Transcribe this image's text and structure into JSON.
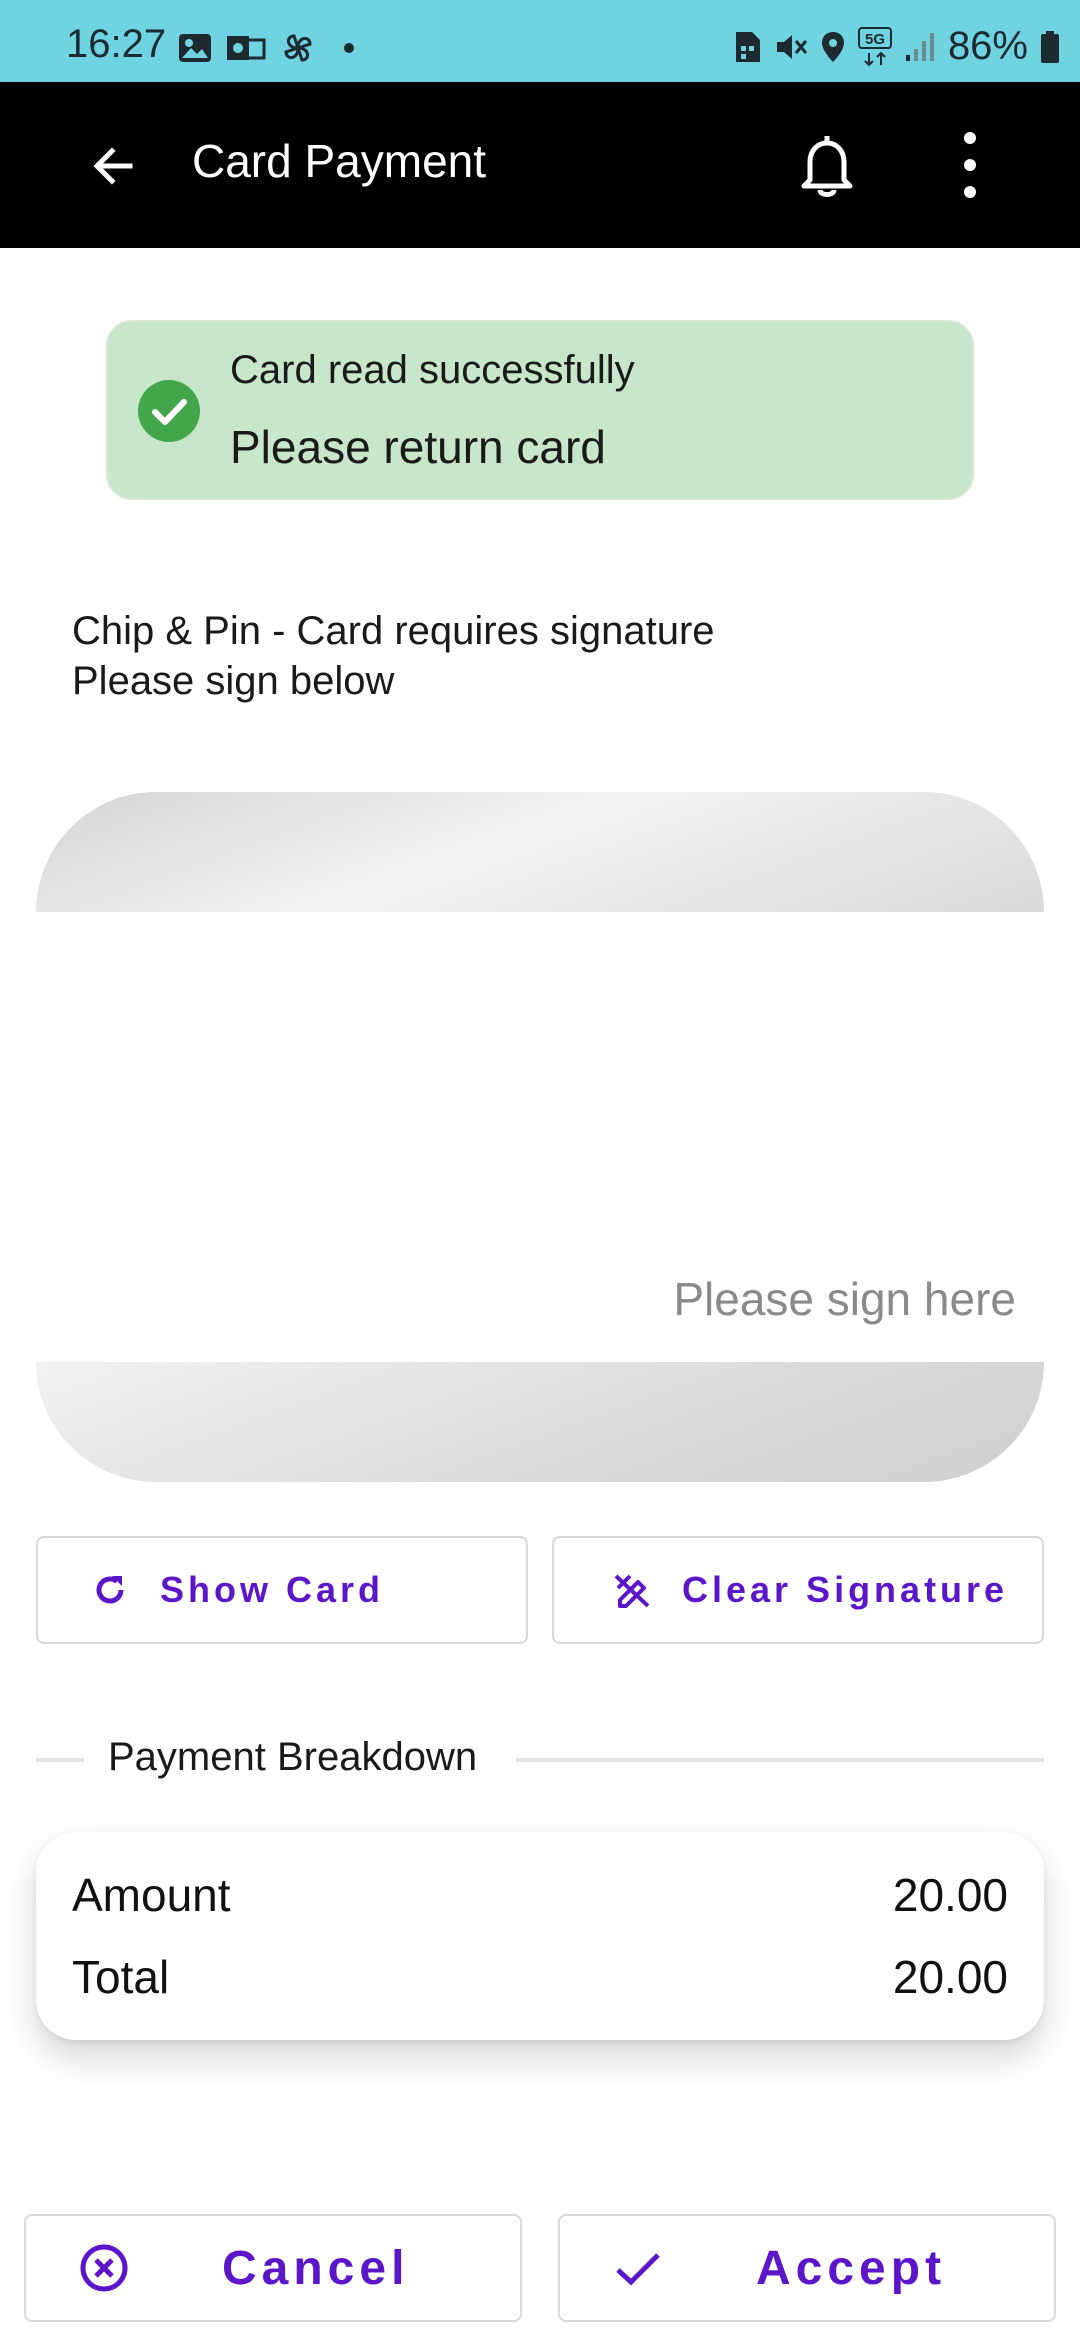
{
  "status_bar": {
    "time": "16:27",
    "battery": "86%",
    "network": "5G",
    "left_icons": [
      "image-icon",
      "outlook-icon",
      "pinwheel-icon",
      "dot-icon"
    ],
    "right_icons": [
      "sim-icon",
      "mute-icon",
      "location-icon",
      "5g-icon",
      "signal-icon",
      "battery-icon"
    ]
  },
  "app_bar": {
    "title": "Card Payment",
    "icons": [
      "back-arrow-icon",
      "bell-icon",
      "more-vert-icon"
    ]
  },
  "banner": {
    "line1": "Card read successfully",
    "line2": "Please return card",
    "color": "#c8e6c9",
    "icon": "check-circle-icon"
  },
  "instruction": {
    "line1": "Chip & Pin - Card requires signature",
    "line2": "Please sign below"
  },
  "signature": {
    "placeholder": "Please sign here"
  },
  "actions": {
    "show_card": "Show Card",
    "clear_signature": "Clear Signature",
    "accent": "#5b16c9"
  },
  "breakdown": {
    "title": "Payment Breakdown",
    "rows": [
      {
        "label": "Amount",
        "value": "20.00"
      },
      {
        "label": "Total",
        "value": "20.00"
      }
    ]
  },
  "footer": {
    "cancel": "Cancel",
    "accept": "Accept"
  }
}
